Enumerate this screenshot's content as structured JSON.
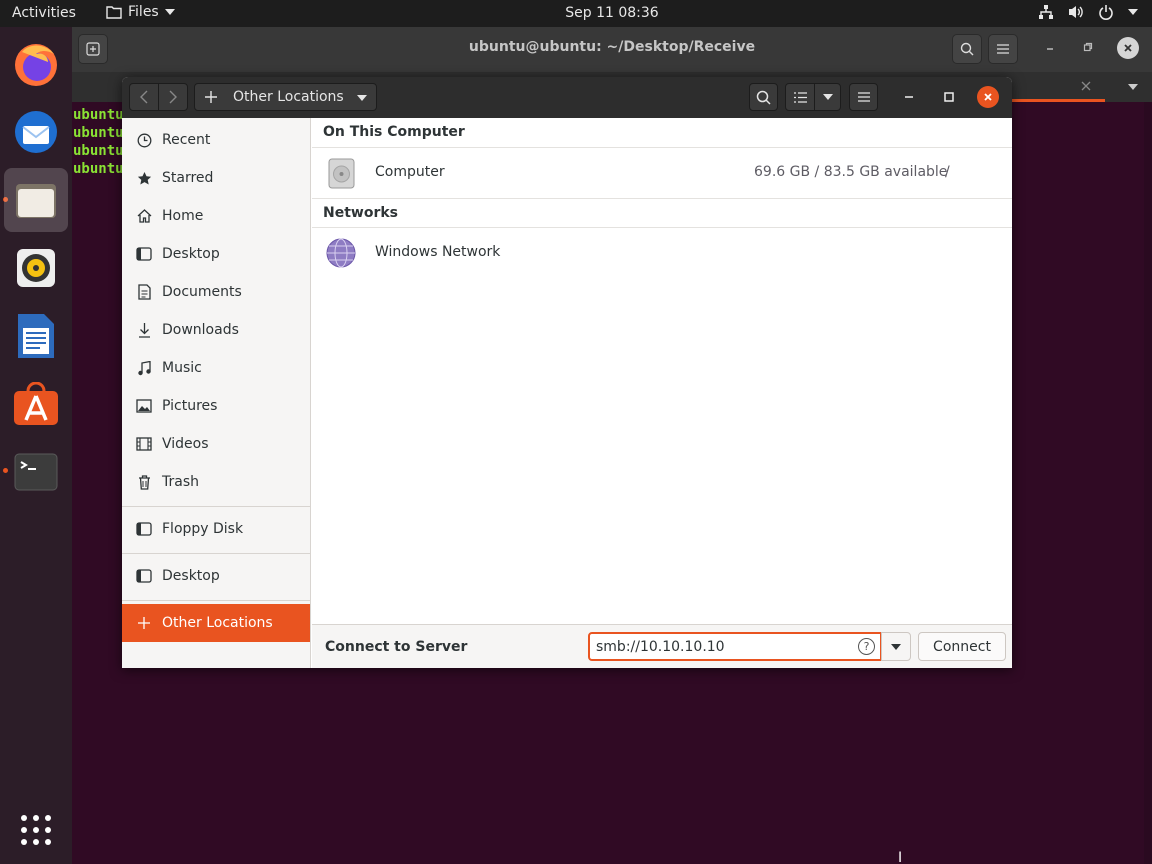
{
  "topbar": {
    "activities": "Activities",
    "app_menu": "Files",
    "clock": "Sep 11  08:36",
    "tray_icons": [
      "network-icon",
      "volume-icon",
      "power-icon",
      "menu-arrow-icon"
    ]
  },
  "dock": {
    "apps": [
      "firefox",
      "thunderbird",
      "files",
      "rhythmbox",
      "libreoffice-writer",
      "ubuntu-software",
      "terminal"
    ],
    "show_apps": "grid-icon"
  },
  "terminal": {
    "title": "ubuntu@ubuntu: ~/Desktop/Receive",
    "lines": [
      "ubuntu",
      "ubuntu",
      "ubuntu",
      "ubuntu"
    ]
  },
  "files": {
    "location_label": "Other Locations",
    "sidebar": {
      "items": [
        {
          "label": "Recent",
          "icon": "clock-icon"
        },
        {
          "label": "Starred",
          "icon": "star-icon"
        },
        {
          "label": "Home",
          "icon": "home-icon"
        },
        {
          "label": "Desktop",
          "icon": "desktop-icon"
        },
        {
          "label": "Documents",
          "icon": "document-icon"
        },
        {
          "label": "Downloads",
          "icon": "download-icon"
        },
        {
          "label": "Music",
          "icon": "music-icon"
        },
        {
          "label": "Pictures",
          "icon": "picture-icon"
        },
        {
          "label": "Videos",
          "icon": "video-icon"
        },
        {
          "label": "Trash",
          "icon": "trash-icon"
        }
      ],
      "devices": [
        {
          "label": "Floppy Disk",
          "icon": "floppy-icon"
        }
      ],
      "bookmarks": [
        {
          "label": "Desktop",
          "icon": "desktop-icon"
        }
      ],
      "other": {
        "label": "Other Locations",
        "icon": "plus-icon"
      }
    },
    "sections": {
      "computer_header": "On This Computer",
      "computer": {
        "label": "Computer",
        "info": "69.6 GB / 83.5 GB available",
        "mount": "/"
      },
      "networks_header": "Networks",
      "network": {
        "label": "Windows Network"
      }
    },
    "connect": {
      "label": "Connect to Server",
      "value": "smb://10.10.10.10",
      "button": "Connect"
    }
  },
  "colors": {
    "accent": "#e95420",
    "desktop_bg": "#300a24",
    "headerbar": "#2d2d2d"
  }
}
